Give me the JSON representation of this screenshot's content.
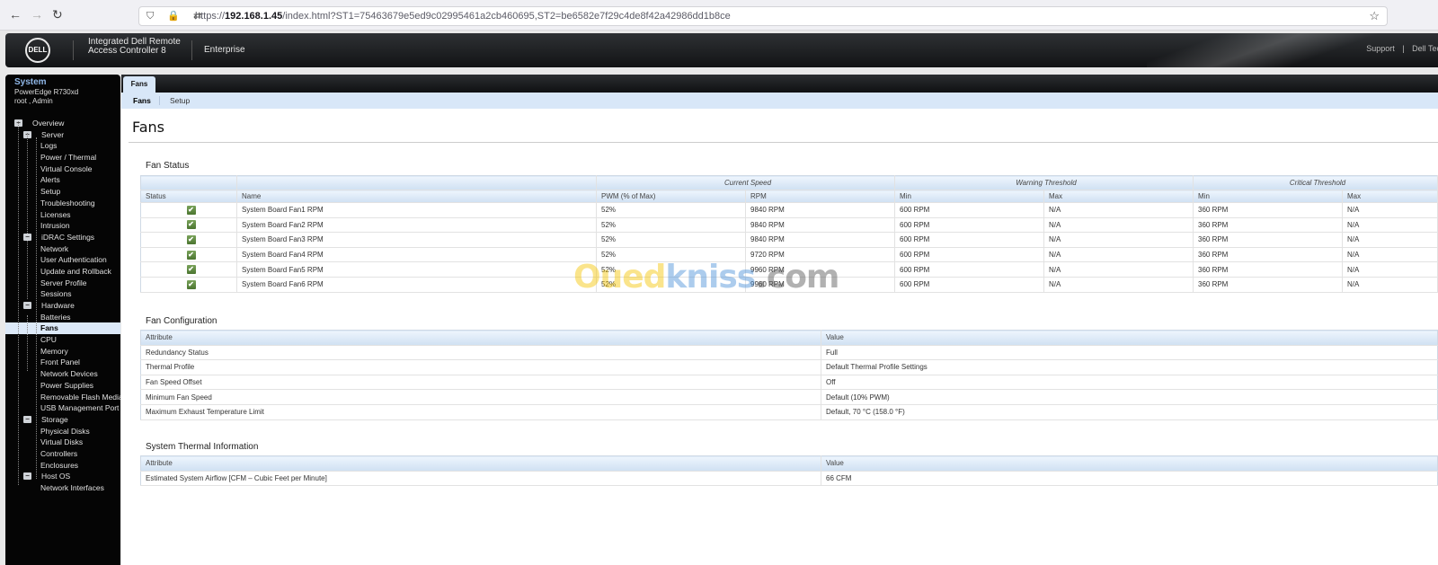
{
  "browser": {
    "url_scheme": "https://",
    "url_host": "192.168.1.45",
    "url_path": "/index.html?ST1=75463679e5ed9c02995461a2cb460695,ST2=be6582e7f29c4de8f42a42986dd1b8ce",
    "back_icon": "←",
    "forward_icon": "→",
    "reload_icon": "↻",
    "url_icons": "⛉ 🔒 ⇄",
    "bookmark_icon": "☆"
  },
  "header": {
    "logo": "DELL",
    "product_line1": "Integrated Dell Remote",
    "product_line2": "Access Controller 8",
    "edition": "Enterprise",
    "links": [
      "Support",
      "|",
      "Dell Tec"
    ]
  },
  "sidebar": {
    "system_title": "System",
    "model": "PowerEdge R730xd",
    "user": "root , Admin",
    "tree": [
      {
        "label": "Overview",
        "level": 0,
        "toggle": "−"
      },
      {
        "label": "Server",
        "level": 1,
        "toggle": "−"
      },
      {
        "label": "Logs",
        "level": 2
      },
      {
        "label": "Power / Thermal",
        "level": 2
      },
      {
        "label": "Virtual Console",
        "level": 2
      },
      {
        "label": "Alerts",
        "level": 2
      },
      {
        "label": "Setup",
        "level": 2
      },
      {
        "label": "Troubleshooting",
        "level": 2
      },
      {
        "label": "Licenses",
        "level": 2
      },
      {
        "label": "Intrusion",
        "level": 2
      },
      {
        "label": "iDRAC Settings",
        "level": 1,
        "toggle": "−"
      },
      {
        "label": "Network",
        "level": 2
      },
      {
        "label": "User Authentication",
        "level": 2
      },
      {
        "label": "Update and Rollback",
        "level": 2
      },
      {
        "label": "Server Profile",
        "level": 2
      },
      {
        "label": "Sessions",
        "level": 2
      },
      {
        "label": "Hardware",
        "level": 1,
        "toggle": "−"
      },
      {
        "label": "Batteries",
        "level": 2
      },
      {
        "label": "Fans",
        "level": 2,
        "selected": true
      },
      {
        "label": "CPU",
        "level": 2
      },
      {
        "label": "Memory",
        "level": 2
      },
      {
        "label": "Front Panel",
        "level": 2
      },
      {
        "label": "Network Devices",
        "level": 2
      },
      {
        "label": "Power Supplies",
        "level": 2
      },
      {
        "label": "Removable Flash Media",
        "level": 2
      },
      {
        "label": "USB Management Port",
        "level": 2
      },
      {
        "label": "Storage",
        "level": 1,
        "toggle": "−"
      },
      {
        "label": "Physical Disks",
        "level": 2
      },
      {
        "label": "Virtual Disks",
        "level": 2
      },
      {
        "label": "Controllers",
        "level": 2
      },
      {
        "label": "Enclosures",
        "level": 2
      },
      {
        "label": "Host OS",
        "level": 1,
        "toggle": "−"
      },
      {
        "label": "Network Interfaces",
        "level": 2
      }
    ]
  },
  "tabs": {
    "main_tab": "Fans",
    "sub_tabs": [
      "Fans",
      "Setup"
    ]
  },
  "page": {
    "title": "Fans"
  },
  "fan_status": {
    "title": "Fan Status",
    "group_headers": [
      "Current Speed",
      "Warning Threshold",
      "Critical Threshold"
    ],
    "columns": [
      "Status",
      "Name",
      "PWM (% of Max)",
      "RPM",
      "Min",
      "Max",
      "Min",
      "Max"
    ],
    "status_icon": "✔",
    "rows": [
      {
        "name": "System Board Fan1 RPM",
        "pwm": "52%",
        "rpm": "9840 RPM",
        "warn_min": "600 RPM",
        "warn_max": "N/A",
        "crit_min": "360 RPM",
        "crit_max": "N/A"
      },
      {
        "name": "System Board Fan2 RPM",
        "pwm": "52%",
        "rpm": "9840 RPM",
        "warn_min": "600 RPM",
        "warn_max": "N/A",
        "crit_min": "360 RPM",
        "crit_max": "N/A"
      },
      {
        "name": "System Board Fan3 RPM",
        "pwm": "52%",
        "rpm": "9840 RPM",
        "warn_min": "600 RPM",
        "warn_max": "N/A",
        "crit_min": "360 RPM",
        "crit_max": "N/A"
      },
      {
        "name": "System Board Fan4 RPM",
        "pwm": "52%",
        "rpm": "9720 RPM",
        "warn_min": "600 RPM",
        "warn_max": "N/A",
        "crit_min": "360 RPM",
        "crit_max": "N/A"
      },
      {
        "name": "System Board Fan5 RPM",
        "pwm": "52%",
        "rpm": "9960 RPM",
        "warn_min": "600 RPM",
        "warn_max": "N/A",
        "crit_min": "360 RPM",
        "crit_max": "N/A"
      },
      {
        "name": "System Board Fan6 RPM",
        "pwm": "52%",
        "rpm": "9960 RPM",
        "warn_min": "600 RPM",
        "warn_max": "N/A",
        "crit_min": "360 RPM",
        "crit_max": "N/A"
      }
    ]
  },
  "fan_configuration": {
    "title": "Fan Configuration",
    "columns": [
      "Attribute",
      "Value"
    ],
    "rows": [
      {
        "attribute": "Redundancy Status",
        "value": "Full"
      },
      {
        "attribute": "Thermal Profile",
        "value": "Default Thermal Profile Settings"
      },
      {
        "attribute": "Fan Speed Offset",
        "value": "Off"
      },
      {
        "attribute": "Minimum Fan Speed",
        "value": "Default (10% PWM)"
      },
      {
        "attribute": "Maximum Exhaust Temperature Limit",
        "value": "Default, 70 °C (158.0 °F)"
      }
    ]
  },
  "thermal_info": {
    "title": "System Thermal Information",
    "columns": [
      "Attribute",
      "Value"
    ],
    "rows": [
      {
        "attribute": "Estimated System Airflow [CFM – Cubic Feet per Minute]",
        "value": "66 CFM"
      }
    ]
  },
  "watermark": {
    "part1": "Oued",
    "part2": "kniss",
    "part3": ".com"
  }
}
